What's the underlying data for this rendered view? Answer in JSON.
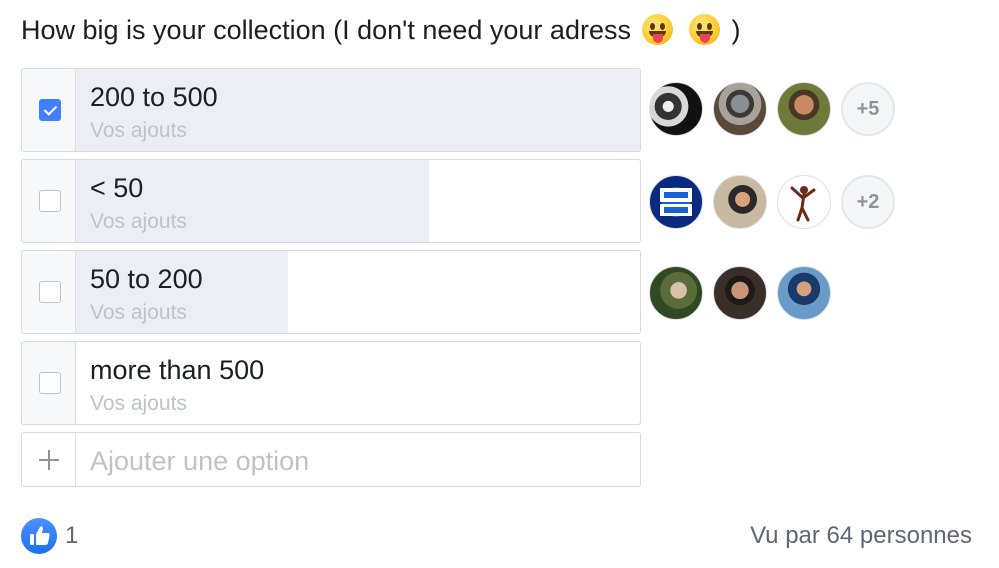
{
  "question": {
    "text": "How big is your collection (I don't need your adress",
    "emojis": [
      "tongue-out-emoji",
      "tongue-out-emoji"
    ],
    "closing": ")"
  },
  "options": [
    {
      "label": "200 to 500",
      "sub": "Vos ajouts",
      "checked": true,
      "fill_fraction": 1.0,
      "more": "+5"
    },
    {
      "label": "< 50",
      "sub": "Vos ajouts",
      "checked": false,
      "fill_fraction": 0.6,
      "more": "+2"
    },
    {
      "label": "50 to 200",
      "sub": "Vos ajouts",
      "checked": false,
      "fill_fraction": 0.375,
      "more": ""
    },
    {
      "label": "more than 500",
      "sub": "Vos ajouts",
      "checked": false,
      "fill_fraction": 0.0,
      "more": ""
    }
  ],
  "add_option": {
    "placeholder": "Ajouter une option",
    "icon": "plus-icon"
  },
  "footer": {
    "like_count": "1",
    "seen_by": "Vu par 64 personnes"
  },
  "colors": {
    "accent": "#4080ff",
    "fill": "#ebeef5",
    "muted_text": "#bec3c9",
    "secondary_text": "#606770"
  }
}
